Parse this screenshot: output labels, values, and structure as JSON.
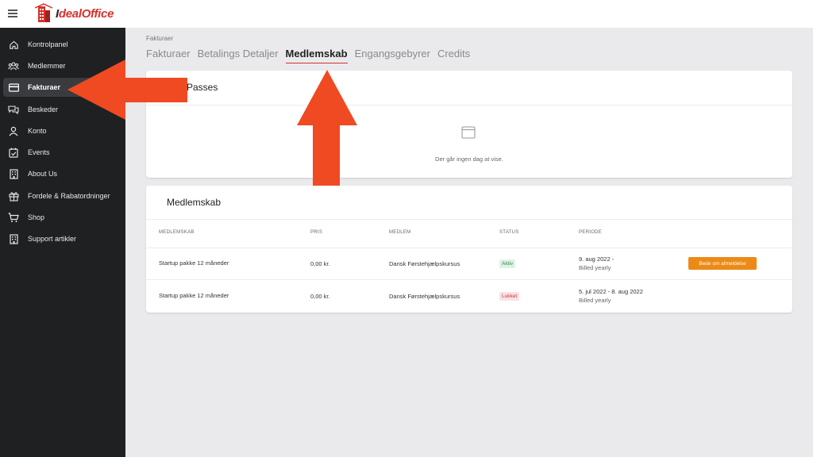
{
  "brand": {
    "name_prefix": "I",
    "name": "dealOffice"
  },
  "colors": {
    "brand_red": "#d9302b",
    "sidebar_bg": "#1f2022",
    "annotation_arrow": "#f04a23",
    "cancel_button": "#ec8a18"
  },
  "sidebar": {
    "items": [
      {
        "label": "Kontrolpanel",
        "icon": "home-icon"
      },
      {
        "label": "Medlemmer",
        "icon": "users-icon"
      },
      {
        "label": "Fakturaer",
        "icon": "credit-card-icon",
        "active": true
      },
      {
        "label": "Beskeder",
        "icon": "chat-icon"
      },
      {
        "label": "Konto",
        "icon": "user-icon"
      },
      {
        "label": "Events",
        "icon": "calendar-check-icon"
      },
      {
        "label": "About Us",
        "icon": "building-icon"
      },
      {
        "label": "Fordele & Rabatordninger",
        "icon": "gift-icon"
      },
      {
        "label": "Shop",
        "icon": "cart-icon"
      },
      {
        "label": "Support artikler",
        "icon": "building-icon"
      }
    ]
  },
  "breadcrumb": "Fakturaer",
  "tabs": [
    {
      "label": "Fakturaer"
    },
    {
      "label": "Betalings Detaljer"
    },
    {
      "label": "Medlemskab",
      "active": true
    },
    {
      "label": "Engangsgebyrer"
    },
    {
      "label": "Credits"
    }
  ],
  "passes_card": {
    "title": "Passes",
    "empty_text": "Der går ingen dag at vise."
  },
  "membership_card": {
    "title": "Medlemskab",
    "columns": [
      "MEDLEMSKAB",
      "PRIS",
      "MEDLEM",
      "STATUS",
      "PERIODE"
    ],
    "rows": [
      {
        "membership": "Startup pakke 12 måneder",
        "price": "0,00 kr.",
        "member": "Dansk Førstehjælpskursus",
        "status": "Aktiv",
        "period": "9. aug 2022 -",
        "billing": "Billed yearly",
        "action": "Bede om afmeldelse"
      },
      {
        "membership": "Startup pakke 12 måneder",
        "price": "0,00 kr.",
        "member": "Dansk Førstehjælpskursus",
        "status": "Lukket",
        "period": "5. jul 2022 - 8. aug 2022",
        "billing": "Billed yearly"
      }
    ]
  }
}
